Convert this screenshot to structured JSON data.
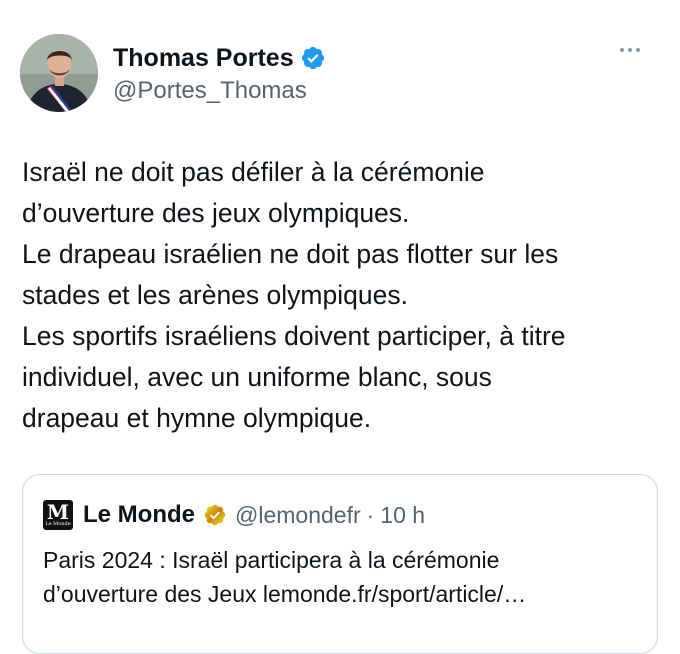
{
  "tweet": {
    "author": {
      "display_name": "Thomas Portes",
      "handle": "@Portes_Thomas",
      "verified_icon": "blue-verified-badge-icon",
      "avatar_icon": "avatar"
    },
    "more_icon": "more-options-icon",
    "text_lines": [
      "Israël ne doit pas défiler à la cérémonie",
      "d’ouverture des jeux olympiques.",
      "Le drapeau israélien ne doit pas flotter sur les",
      "stades et les arènes olympiques.",
      "Les sportifs israéliens doivent participer, à titre",
      "individuel, avec un uniforme blanc, sous",
      "drapeau et hymne olympique."
    ]
  },
  "quote": {
    "logo_letter": "M",
    "logo_sub": "Le Monde",
    "display_name": "Le Monde",
    "badge_icon": "gold-verified-badge-icon",
    "handle": "@lemondefr",
    "separator": "·",
    "time": "10 h",
    "text_lines": [
      "Paris 2024 : Israël participera à la cérémonie",
      "d’ouverture des Jeux lemonde.fr/sport/article/…"
    ]
  },
  "colors": {
    "text": "#0f1419",
    "secondary": "#536471",
    "verified_blue": "#1d9bf0",
    "gold": "#e2b719",
    "border": "#cfd9de"
  }
}
